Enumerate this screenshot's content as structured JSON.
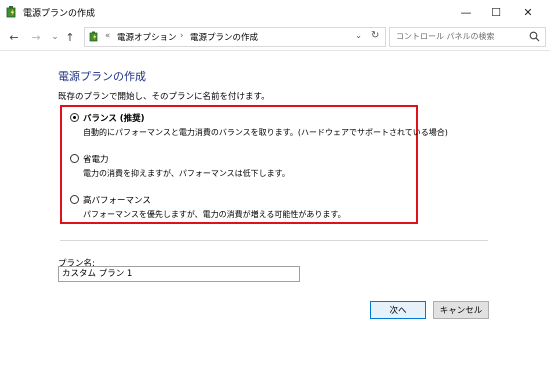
{
  "window": {
    "title": "電源プランの作成",
    "minimize": "—",
    "maximize": "☐",
    "close": "✕"
  },
  "nav": {
    "back": "←",
    "forward": "→",
    "recent": "⌄",
    "up": "↑"
  },
  "address": {
    "overflow": "«",
    "crumb1": "電源オプション",
    "separator": "›",
    "crumb2": "電源プランの作成",
    "dropdown": "⌄",
    "refresh": "↻"
  },
  "search": {
    "placeholder": "コントロール パネルの検索",
    "icon": "search-icon"
  },
  "page": {
    "heading": "電源プランの作成",
    "instruction": "既存のプランで開始し、そのプランに名前を付けます。"
  },
  "plans": [
    {
      "name": "バランス (推奨)",
      "selected": true,
      "desc": "自動的にパフォーマンスと電力消費のバランスを取ります。(ハードウェアでサポートされている場合)"
    },
    {
      "name": "省電力",
      "selected": false,
      "desc": "電力の消費を抑えますが、パフォーマンスは低下します。"
    },
    {
      "name": "高パフォーマンス",
      "selected": false,
      "desc": "パフォーマンスを優先しますが、電力の消費が増える可能性があります。"
    }
  ],
  "plan_name": {
    "label": "プラン名:",
    "value": "カスタム プラン 1"
  },
  "buttons": {
    "next": "次へ",
    "cancel": "キャンセル"
  },
  "colors": {
    "heading": "#1e3287",
    "highlight_box": "#e0101a"
  }
}
